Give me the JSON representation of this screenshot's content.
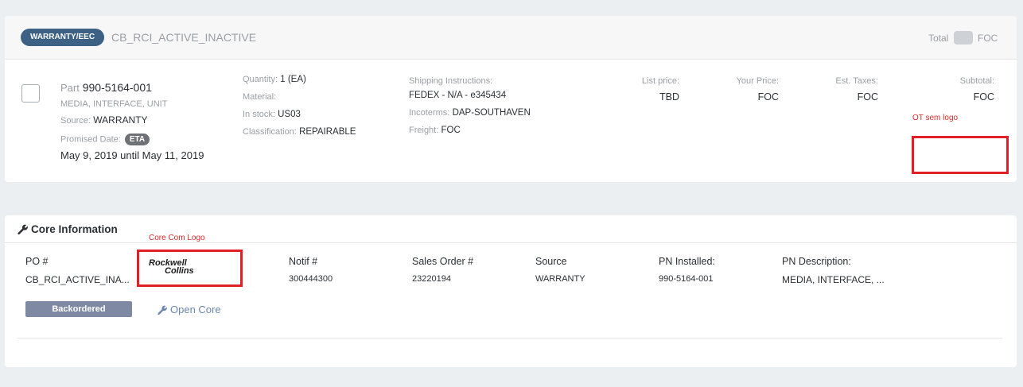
{
  "header": {
    "badge": "WARRANTY/EEC",
    "order_name": "CB_RCI_ACTIVE_INACTIVE",
    "total_label": "Total",
    "foc_label": "FOC"
  },
  "item": {
    "part_label": "Part",
    "part_number": "990-5164-001",
    "description": "MEDIA, INTERFACE, UNIT",
    "source_label": "Source:",
    "source_value": "WARRANTY",
    "promised_label": "Promised Date:",
    "eta_badge": "ETA",
    "dates": "May 9, 2019 until May 11, 2019",
    "quantity_label": "Quantity:",
    "quantity_value": "1 (EA)",
    "material_label": "Material:",
    "instock_label": "In stock:",
    "instock_value": "US03",
    "classification_label": "Classification:",
    "classification_value": "REPAIRABLE",
    "shipping_label": "Shipping Instructions:",
    "shipping_value": "FEDEX - N/A - e345434",
    "incoterms_label": "Incoterms:",
    "incoterms_value": "DAP-SOUTHAVEN",
    "freight_label": "Freight:",
    "freight_value": "FOC",
    "list_price_label": "List price:",
    "list_price_value": "TBD",
    "your_price_label": "Your Price:",
    "your_price_value": "FOC",
    "est_taxes_label": "Est. Taxes:",
    "est_taxes_value": "FOC",
    "subtotal_label": "Subtotal:",
    "subtotal_value": "FOC"
  },
  "annotations": {
    "ot_text": "OT sem logo",
    "core_text": "Core Com Logo",
    "color": "#e01f26"
  },
  "core": {
    "title": "Core Information",
    "po_label": "PO #",
    "po_value": "CB_RCI_ACTIVE_INA...",
    "logo_line1": "Rockwell",
    "logo_line2": "Collins",
    "notif_label": "Notif #",
    "notif_value": "300444300",
    "sales_order_label": "Sales Order #",
    "sales_order_value": "23220194",
    "source_label": "Source",
    "source_value": "WARRANTY",
    "pn_installed_label": "PN Installed:",
    "pn_installed_value": "990-5164-001",
    "pn_desc_label": "PN Description:",
    "pn_desc_value": "MEDIA, INTERFACE, ...",
    "backordered_label": "Backordered",
    "open_core_label": "Open Core"
  },
  "colors": {
    "badge": "#3c6185",
    "backordered": "#8089a4",
    "link": "#6a87b4",
    "background": "#eceff2"
  }
}
